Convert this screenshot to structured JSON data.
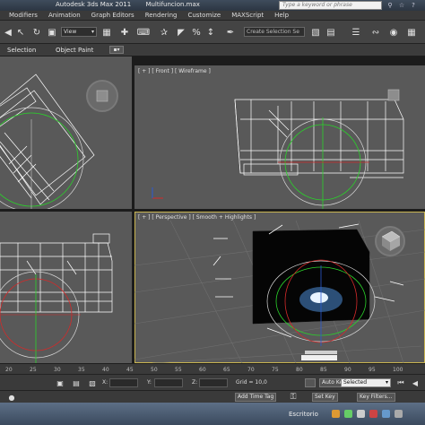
{
  "window": {
    "app_title": "Autodesk 3ds Max 2011",
    "file_name": "Multifuncion.max",
    "search_placeholder": "Type a keyword or phrase"
  },
  "menu": [
    "Modifiers",
    "Animation",
    "Graph Editors",
    "Rendering",
    "Customize",
    "MAXScript",
    "Help"
  ],
  "toolbar": {
    "reference_coord": "View",
    "selection_set_placeholder": "Create Selection Se"
  },
  "ribbon": {
    "tabs": [
      "Selection",
      "Object Paint"
    ],
    "toggle_label": "▪▾"
  },
  "viewports": {
    "front_label": "[ + ] [ Front ] [ Wireframe ]",
    "perspective_label": "[ + ] [ Perspective ] [ Smooth + Highlights ]"
  },
  "timeline": {
    "ticks": [
      "20",
      "25",
      "30",
      "35",
      "40",
      "45",
      "50",
      "55",
      "60",
      "65",
      "70",
      "75",
      "80",
      "85",
      "90",
      "95",
      "100"
    ]
  },
  "status": {
    "x_label": "X:",
    "y_label": "Y:",
    "z_label": "Z:",
    "grid_label": "Grid = 10,0",
    "auto_key": "Auto Key",
    "set_key": "Set Key",
    "key_mode": "Selected",
    "key_filters": "Key Filters...",
    "add_time_tag": "Add Time Tag"
  },
  "taskbar": {
    "desktop_label": "Escritorio"
  },
  "colors": {
    "viewport_bg": "#595959",
    "active_viewport_border": "#c8b451",
    "wire_color": "#ffffff",
    "axis_x": "#d22a2a",
    "axis_y": "#2ad22a",
    "axis_z": "#2a5ad2"
  }
}
